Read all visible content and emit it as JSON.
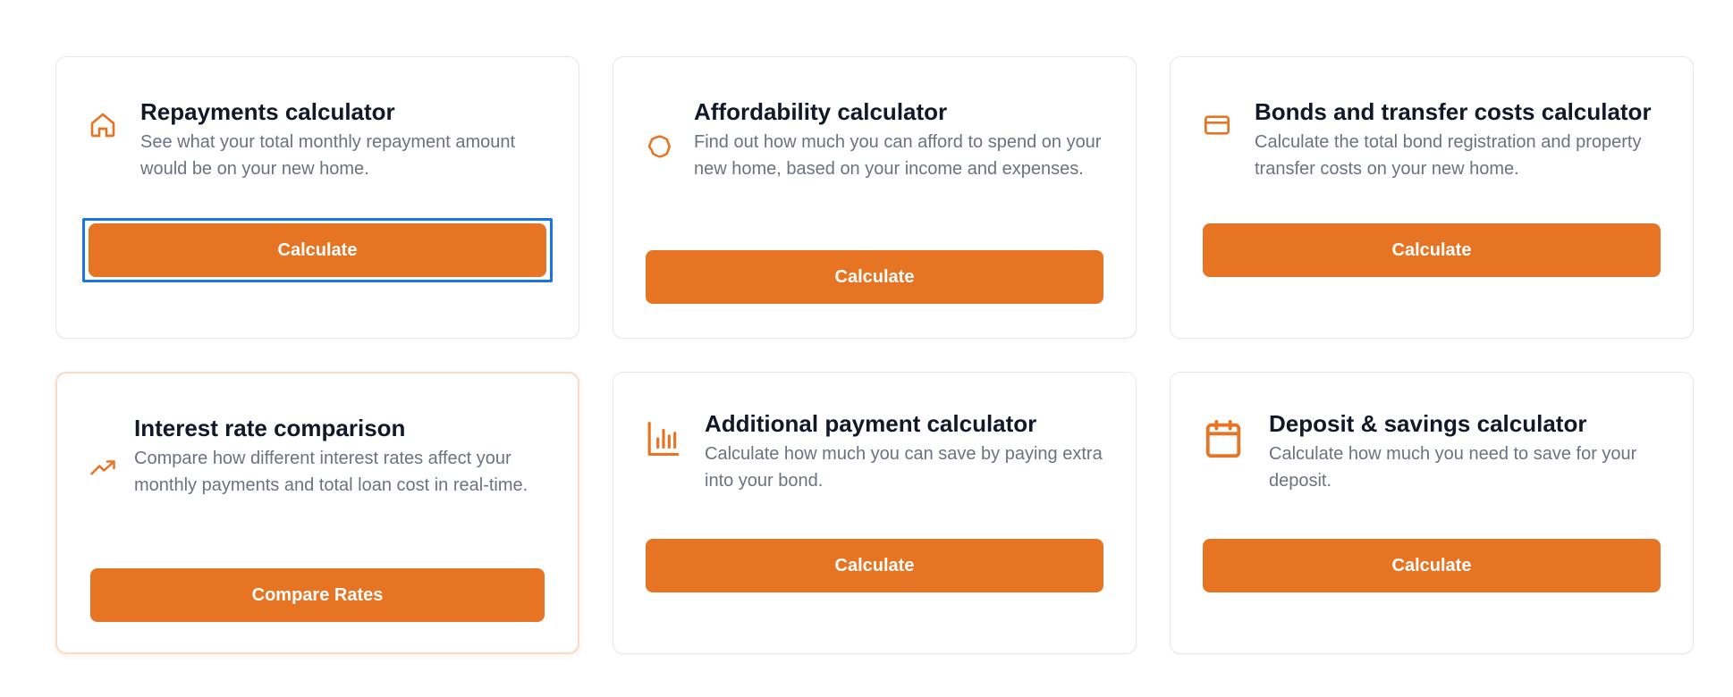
{
  "cards": [
    {
      "icon": "house-icon",
      "title": "Repayments calculator",
      "description": "See what your total monthly repayment amount would be on your new home.",
      "button": "Calculate"
    },
    {
      "icon": "circle-badge-icon",
      "title": "Affordability calculator",
      "description": "Find out how much you can afford to spend on your new home, based on your income and expenses.",
      "button": "Calculate"
    },
    {
      "icon": "credit-card-icon",
      "title": "Bonds and transfer costs calculator",
      "description": "Calculate the total bond registration and property transfer costs on your new home.",
      "button": "Calculate"
    },
    {
      "icon": "trending-up-icon",
      "title": "Interest rate comparison",
      "description": "Compare how different interest rates affect your monthly payments and total loan cost in real-time.",
      "button": "Compare Rates"
    },
    {
      "icon": "bar-chart-icon",
      "title": "Additional payment calculator",
      "description": "Calculate how much you can save by paying extra into your bond.",
      "button": "Calculate"
    },
    {
      "icon": "calendar-icon",
      "title": "Deposit & savings calculator",
      "description": "Calculate how much you need to save for your deposit.",
      "button": "Calculate"
    }
  ],
  "colors": {
    "accent": "#e67422",
    "focus": "#1a73e8",
    "highlight_border": "#fcd9c4"
  }
}
